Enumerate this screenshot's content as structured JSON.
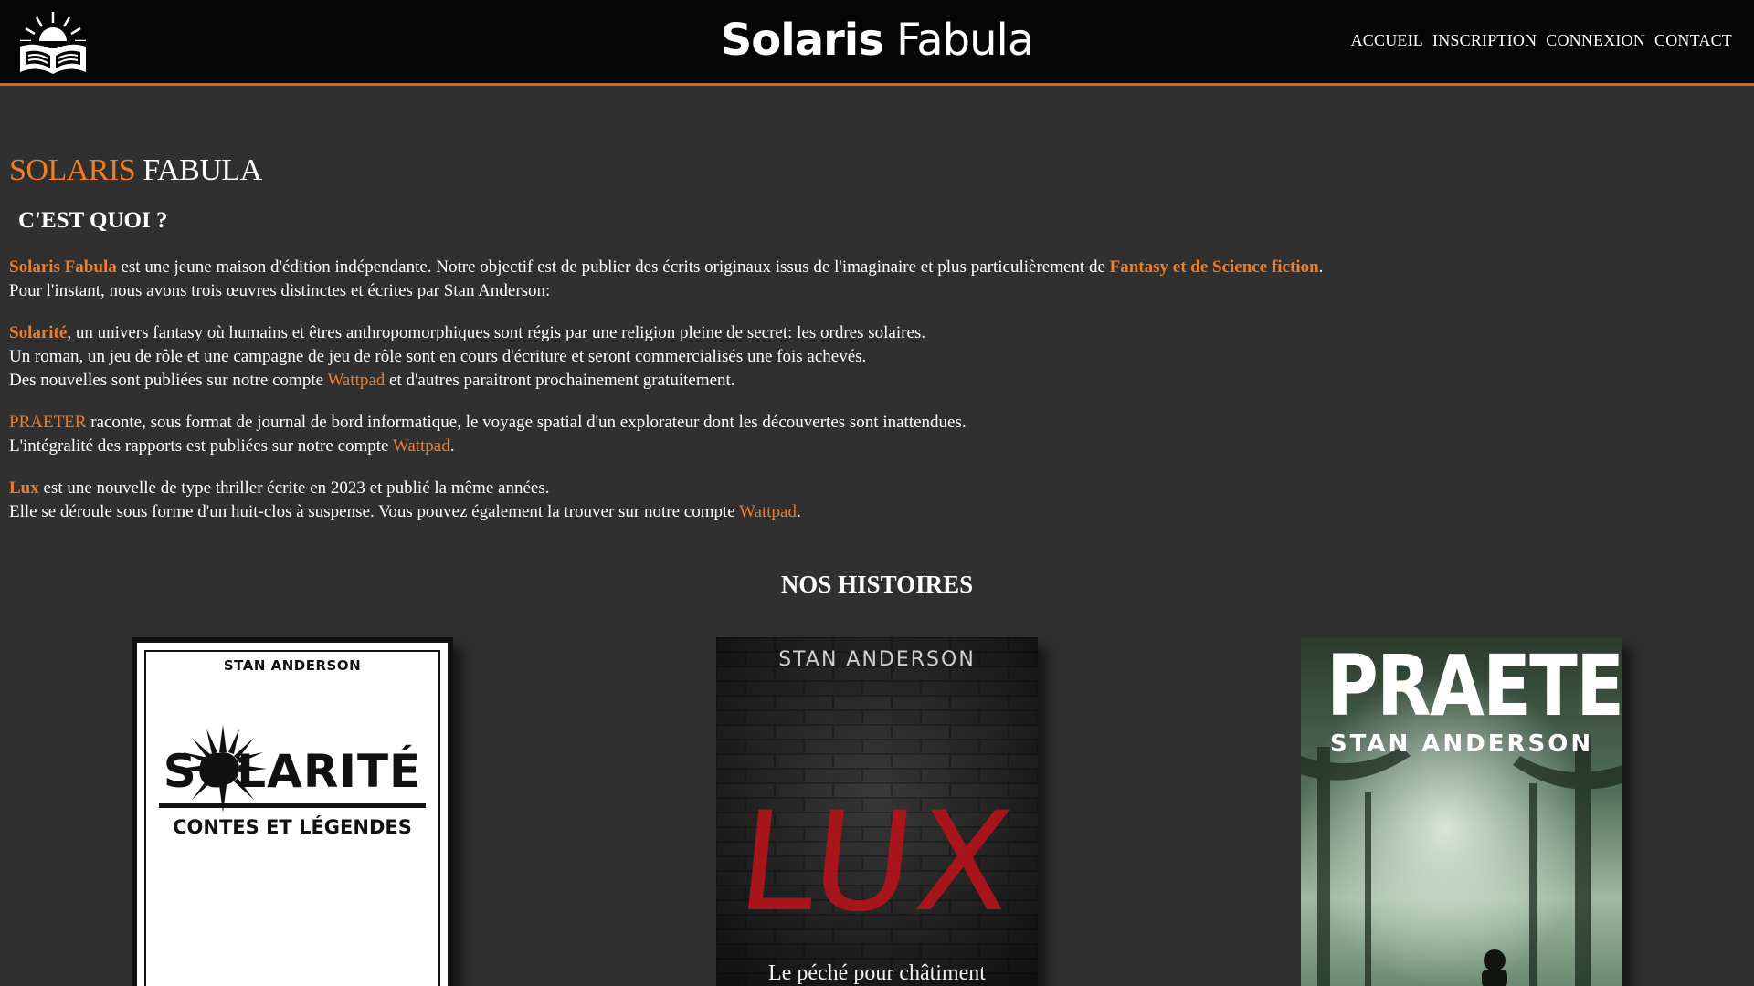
{
  "header": {
    "brand_bold": "Solaris",
    "brand_light": "Fabula",
    "nav": [
      "ACCUEIL",
      "INSCRIPTION",
      "CONNEXION",
      "CONTACT"
    ],
    "logo_icon": "book-sun-icon"
  },
  "main": {
    "title_accent": "SOLARIS",
    "title_rest": "FABULA",
    "subtitle": "C'EST QUOI ?",
    "intro": {
      "name": "Solaris Fabula",
      "text1": " est une jeune maison d'édition indépendante. Notre objectif est de publier des écrits originaux issus de l'imaginaire et plus particulièrement de ",
      "genre": "Fantasy et de Science fiction",
      "text2": ".",
      "line2": "Pour l'instant, nous avons trois œuvres distinctes et écrites par Stan Anderson:"
    },
    "solarite": {
      "name": "Solarité",
      "line1": ", un univers fantasy où humains et êtres anthropomorphiques sont régis par une religion pleine de secret: les ordres solaires.",
      "line2": "Un roman, un jeu de rôle et une campagne de jeu de rôle sont en cours d'écriture et seront commercialisés une fois achevés.",
      "line3a": "Des nouvelles sont publiées sur notre compte ",
      "link": "Wattpad",
      "line3b": " et d'autres paraitront prochainement gratuitement."
    },
    "praeter": {
      "name": "PRAETER",
      "line1": " raconte, sous format de journal de bord informatique, le voyage spatial d'un explorateur dont les découvertes sont inattendues.",
      "line2a": "L'intégralité des rapports est publiées sur notre compte ",
      "link": "Wattpad",
      "line2b": "."
    },
    "lux": {
      "name": "Lux",
      "line1": " est une nouvelle de type thriller écrite en 2023 et publié la même années.",
      "line2a": "Elle se déroule sous forme d'un huit-clos à suspense. Vous pouvez également la trouver sur notre compte ",
      "link": "Wattpad",
      "line2b": "."
    },
    "section_title": "NOS HISTOIRES"
  },
  "covers": [
    {
      "author": "STAN ANDERSON",
      "title": "SOLARITÉ",
      "subtitle": "CONTES ET LÉGENDES"
    },
    {
      "author": "STAN  ANDERSON",
      "title": "LUX",
      "subtitle": "Le péché pour châtiment"
    },
    {
      "author": "STAN  ANDERSON",
      "title": "PRAETER"
    }
  ],
  "colors": {
    "accent": "#f07c24",
    "background": "#303030",
    "topbar": "#050505"
  }
}
